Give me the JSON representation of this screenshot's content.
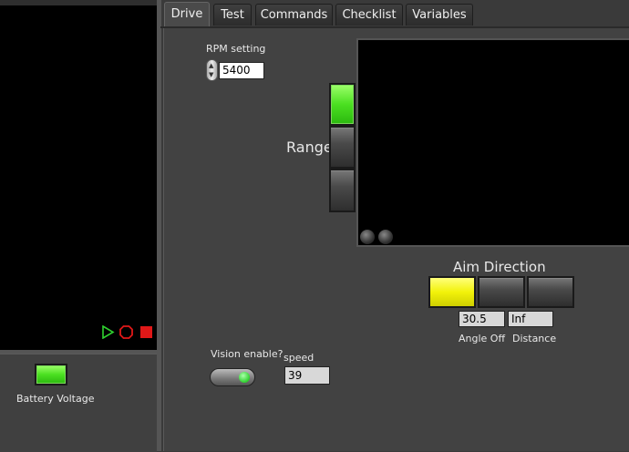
{
  "tabs": [
    {
      "label": "Drive",
      "active": true
    },
    {
      "label": "Test",
      "active": false
    },
    {
      "label": "Commands",
      "active": false
    },
    {
      "label": "Checklist",
      "active": false
    },
    {
      "label": "Variables",
      "active": false
    }
  ],
  "battery": {
    "label": "Battery Voltage",
    "led_color": "#4be021"
  },
  "run_controls": {
    "run_icon": "play-icon",
    "abort_icon": "abort-icon",
    "stop_icon": "stop-icon"
  },
  "rpm": {
    "label": "RPM setting",
    "value": "5400"
  },
  "range": {
    "label": "Range",
    "leds": [
      "on",
      "off",
      "off"
    ]
  },
  "aim": {
    "title": "Aim Direction",
    "leds": [
      "yellow",
      "off",
      "off"
    ],
    "angle_off_value": "30.5",
    "angle_off_label": "Angle Off",
    "distance_value": "Inf",
    "distance_label": "Distance"
  },
  "vision": {
    "label": "Vision enable?",
    "enabled": true
  },
  "speed": {
    "label": "speed",
    "value": "39"
  }
}
